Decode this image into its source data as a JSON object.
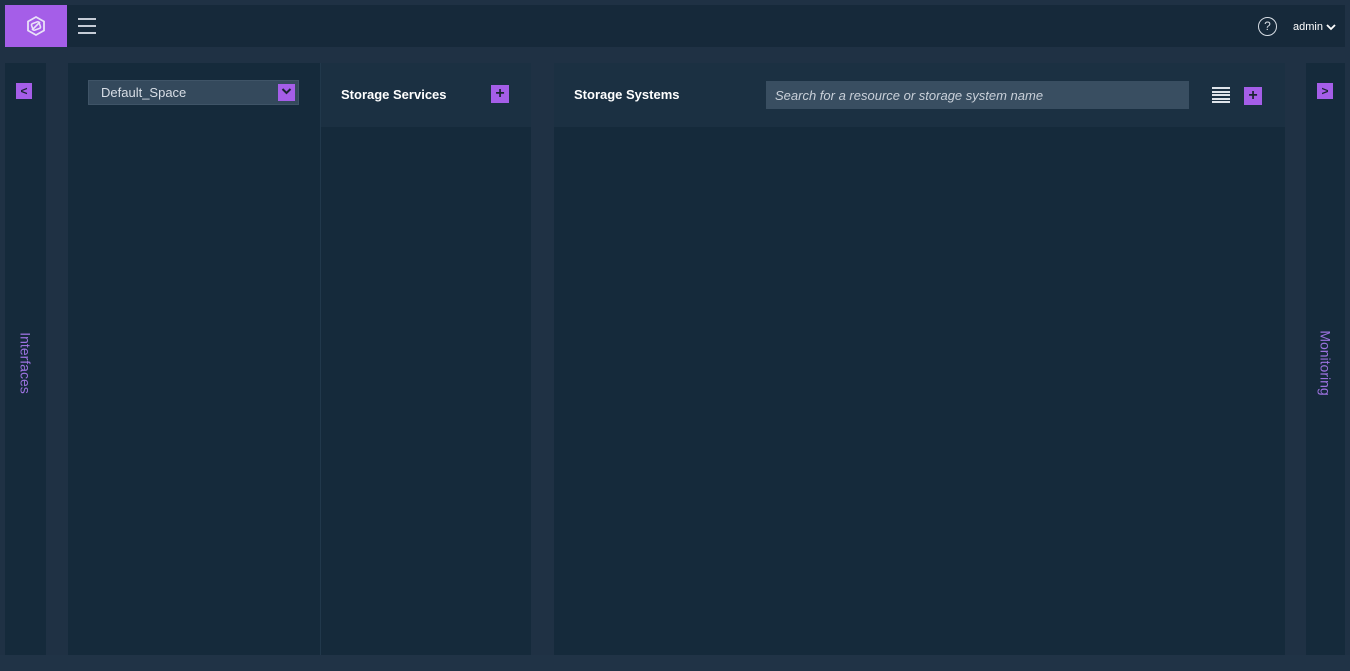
{
  "app": {
    "logo_icon": "storage-hexagon-logo-icon",
    "accent_color": "#a55ee8",
    "background_color": "#16293a"
  },
  "header": {
    "menu_icon": "hamburger-icon",
    "help_glyph": "?",
    "user": {
      "label": "admin",
      "caret": "⌄"
    }
  },
  "left_drawer": {
    "toggle_glyph": "<",
    "label": "Interfaces"
  },
  "right_drawer": {
    "toggle_glyph": ">",
    "label": "Monitoring"
  },
  "spaces_panel": {
    "selected_space": "Default_Space",
    "caret_glyph": "⌄"
  },
  "services_panel": {
    "title": "Storage Services",
    "add_glyph": "+"
  },
  "systems_panel": {
    "title": "Storage Systems",
    "search_placeholder": "Search for a resource or storage system name",
    "search_value": "",
    "list_view_icon": "list-view-icon",
    "add_glyph": "+"
  }
}
